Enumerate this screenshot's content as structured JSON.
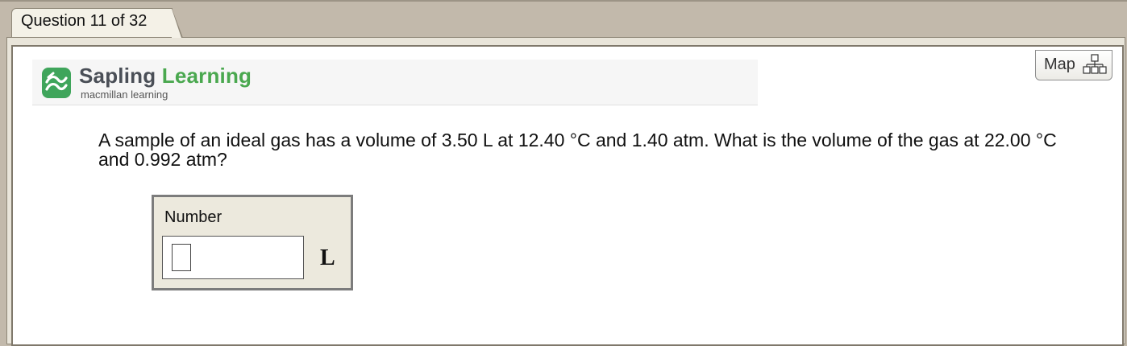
{
  "tab": {
    "label": "Question 11 of 32"
  },
  "logo": {
    "name_part1": "Sapling",
    "name_part2": "Learning",
    "subtitle": "macmillan learning",
    "brand_color": "#4aa84f"
  },
  "map": {
    "label": "Map",
    "icon": "sitemap-icon"
  },
  "question": {
    "text": "A sample of an ideal gas has a volume of 3.50 L at 12.40 °C and 1.40 atm. What is the volume of the gas at 22.00 °C and 0.992 atm?"
  },
  "answer": {
    "label": "Number",
    "value": "",
    "unit": "L"
  }
}
